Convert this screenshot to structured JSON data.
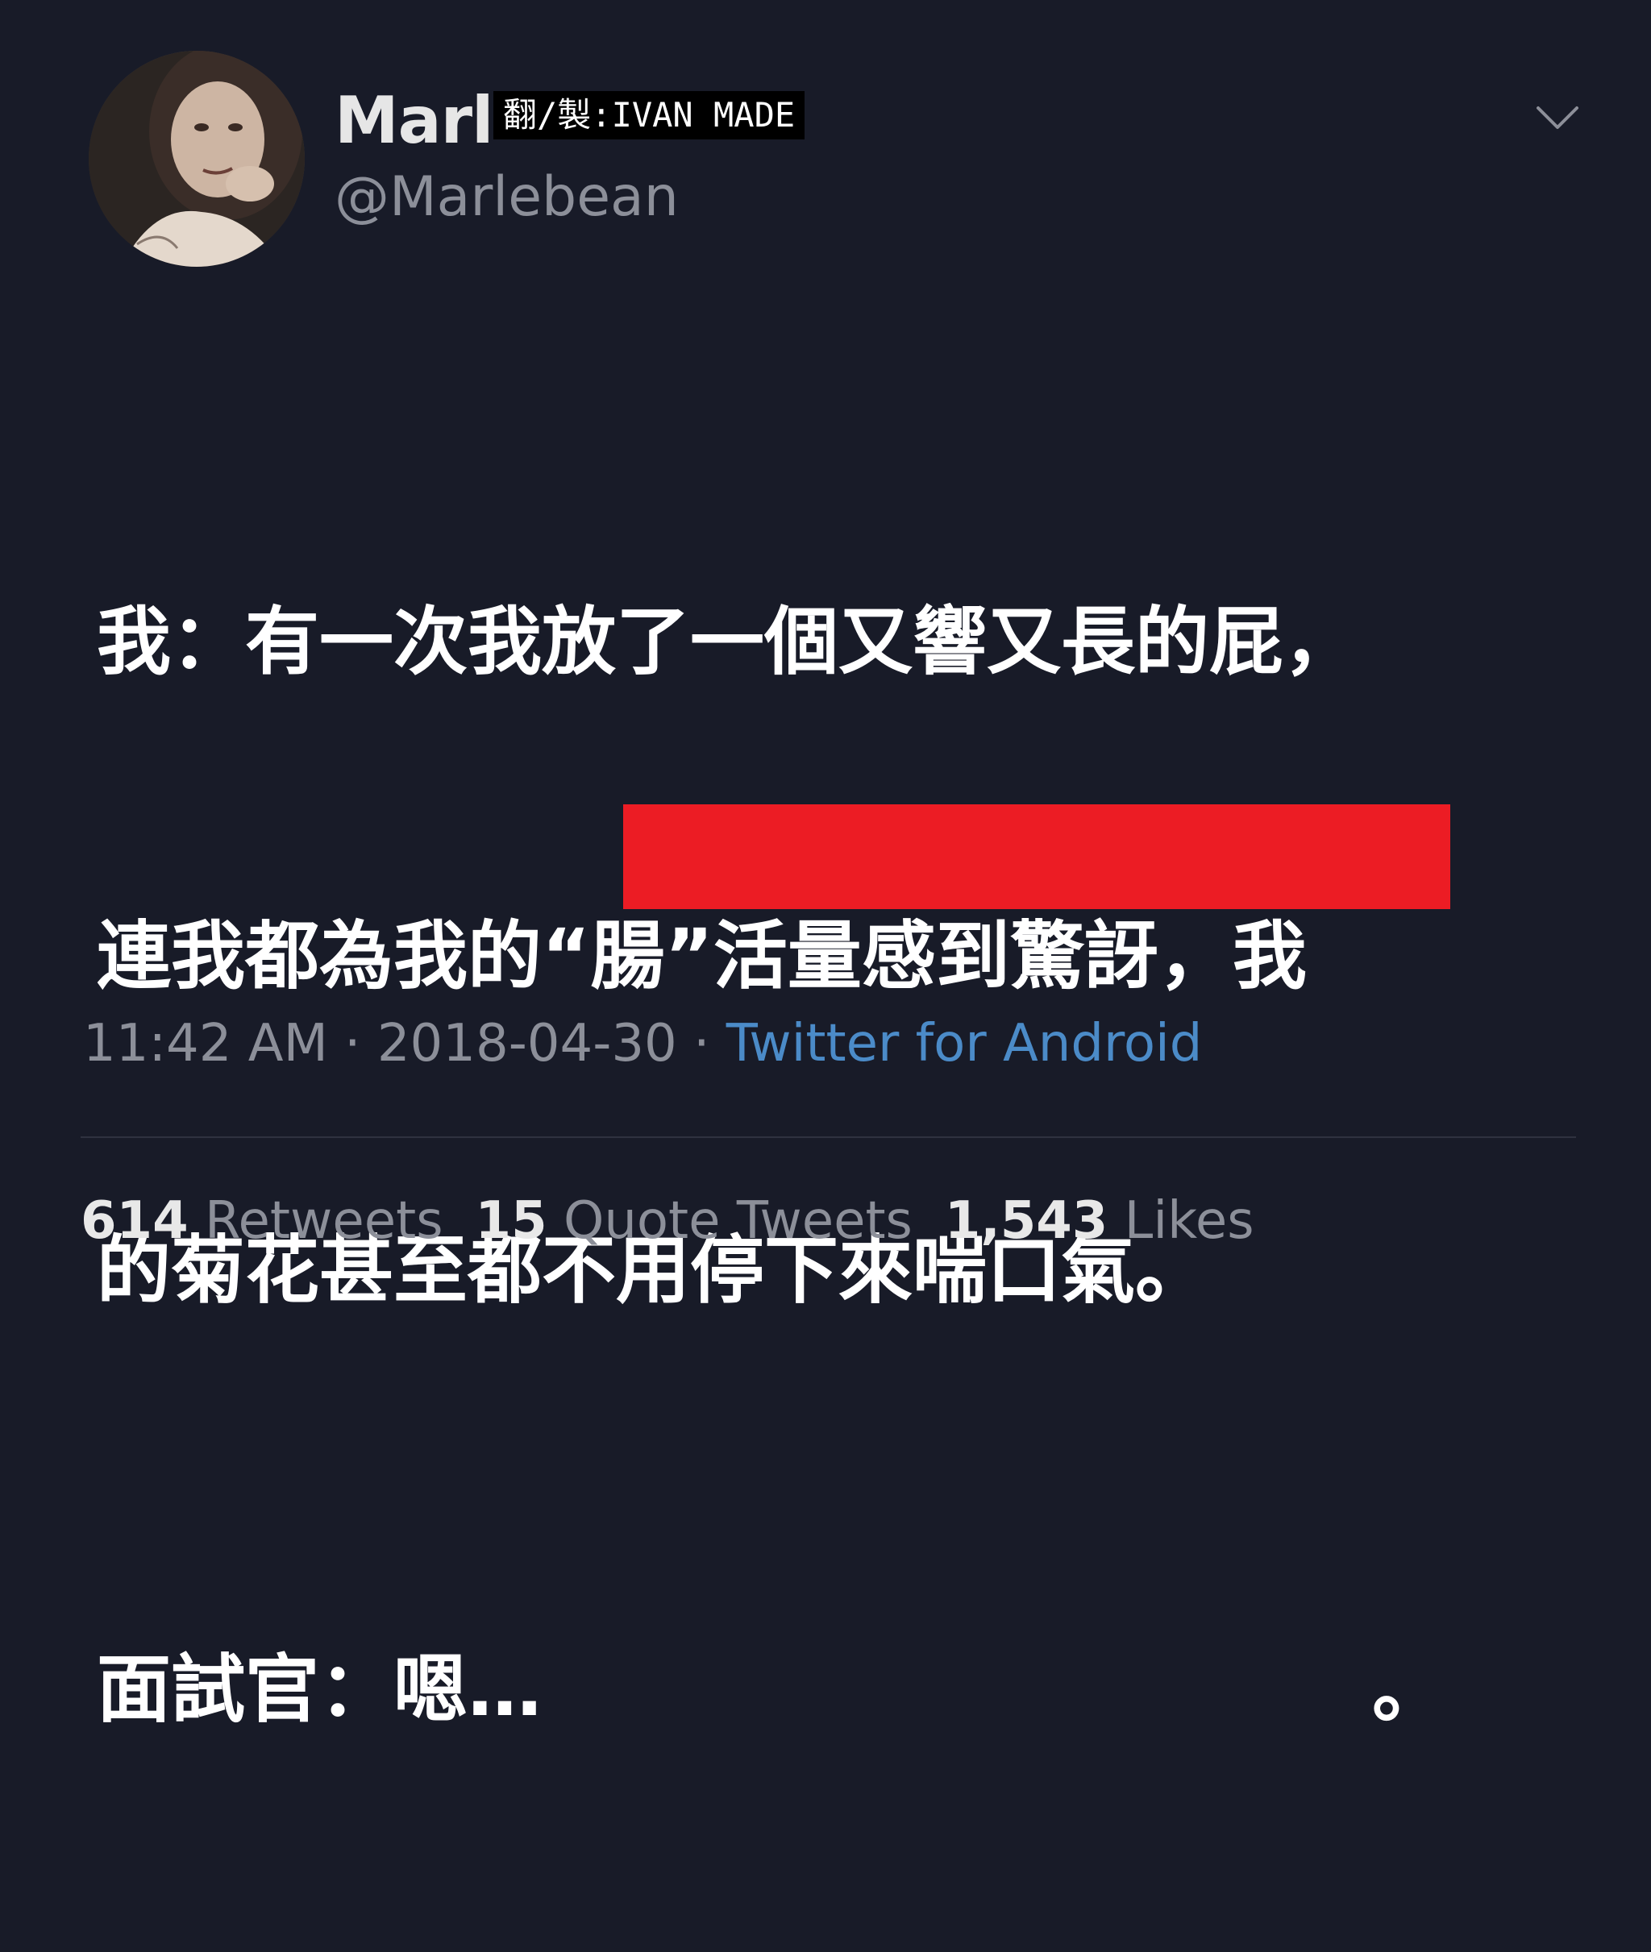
{
  "user": {
    "display_name": "Marl",
    "handle": "@Marlebean",
    "avatar": "profile-photo"
  },
  "watermark": "翻/製:IVAN MADE",
  "menu_icon": "chevron-down-icon",
  "tweet": {
    "line1": "我：有一次我放了一個又響又長的屁，",
    "line2": "連我都為我的“腸”活量感到驚訝，我",
    "line3": "的菊花甚至都不用停下來喘口氣。",
    "reply": "面試官：嗯…",
    "reply_end": "。"
  },
  "redaction_color": "#ec1c24",
  "meta": {
    "time": "11:42 AM",
    "sep1": " · ",
    "date": "2018-04-30",
    "sep2": " · ",
    "source": "Twitter for Android"
  },
  "stats": {
    "retweets_count": "614",
    "retweets_label": "Retweets",
    "quotes_count": "15",
    "quotes_label": "Quote Tweets",
    "likes_count": "1,543",
    "likes_label": "Likes"
  }
}
